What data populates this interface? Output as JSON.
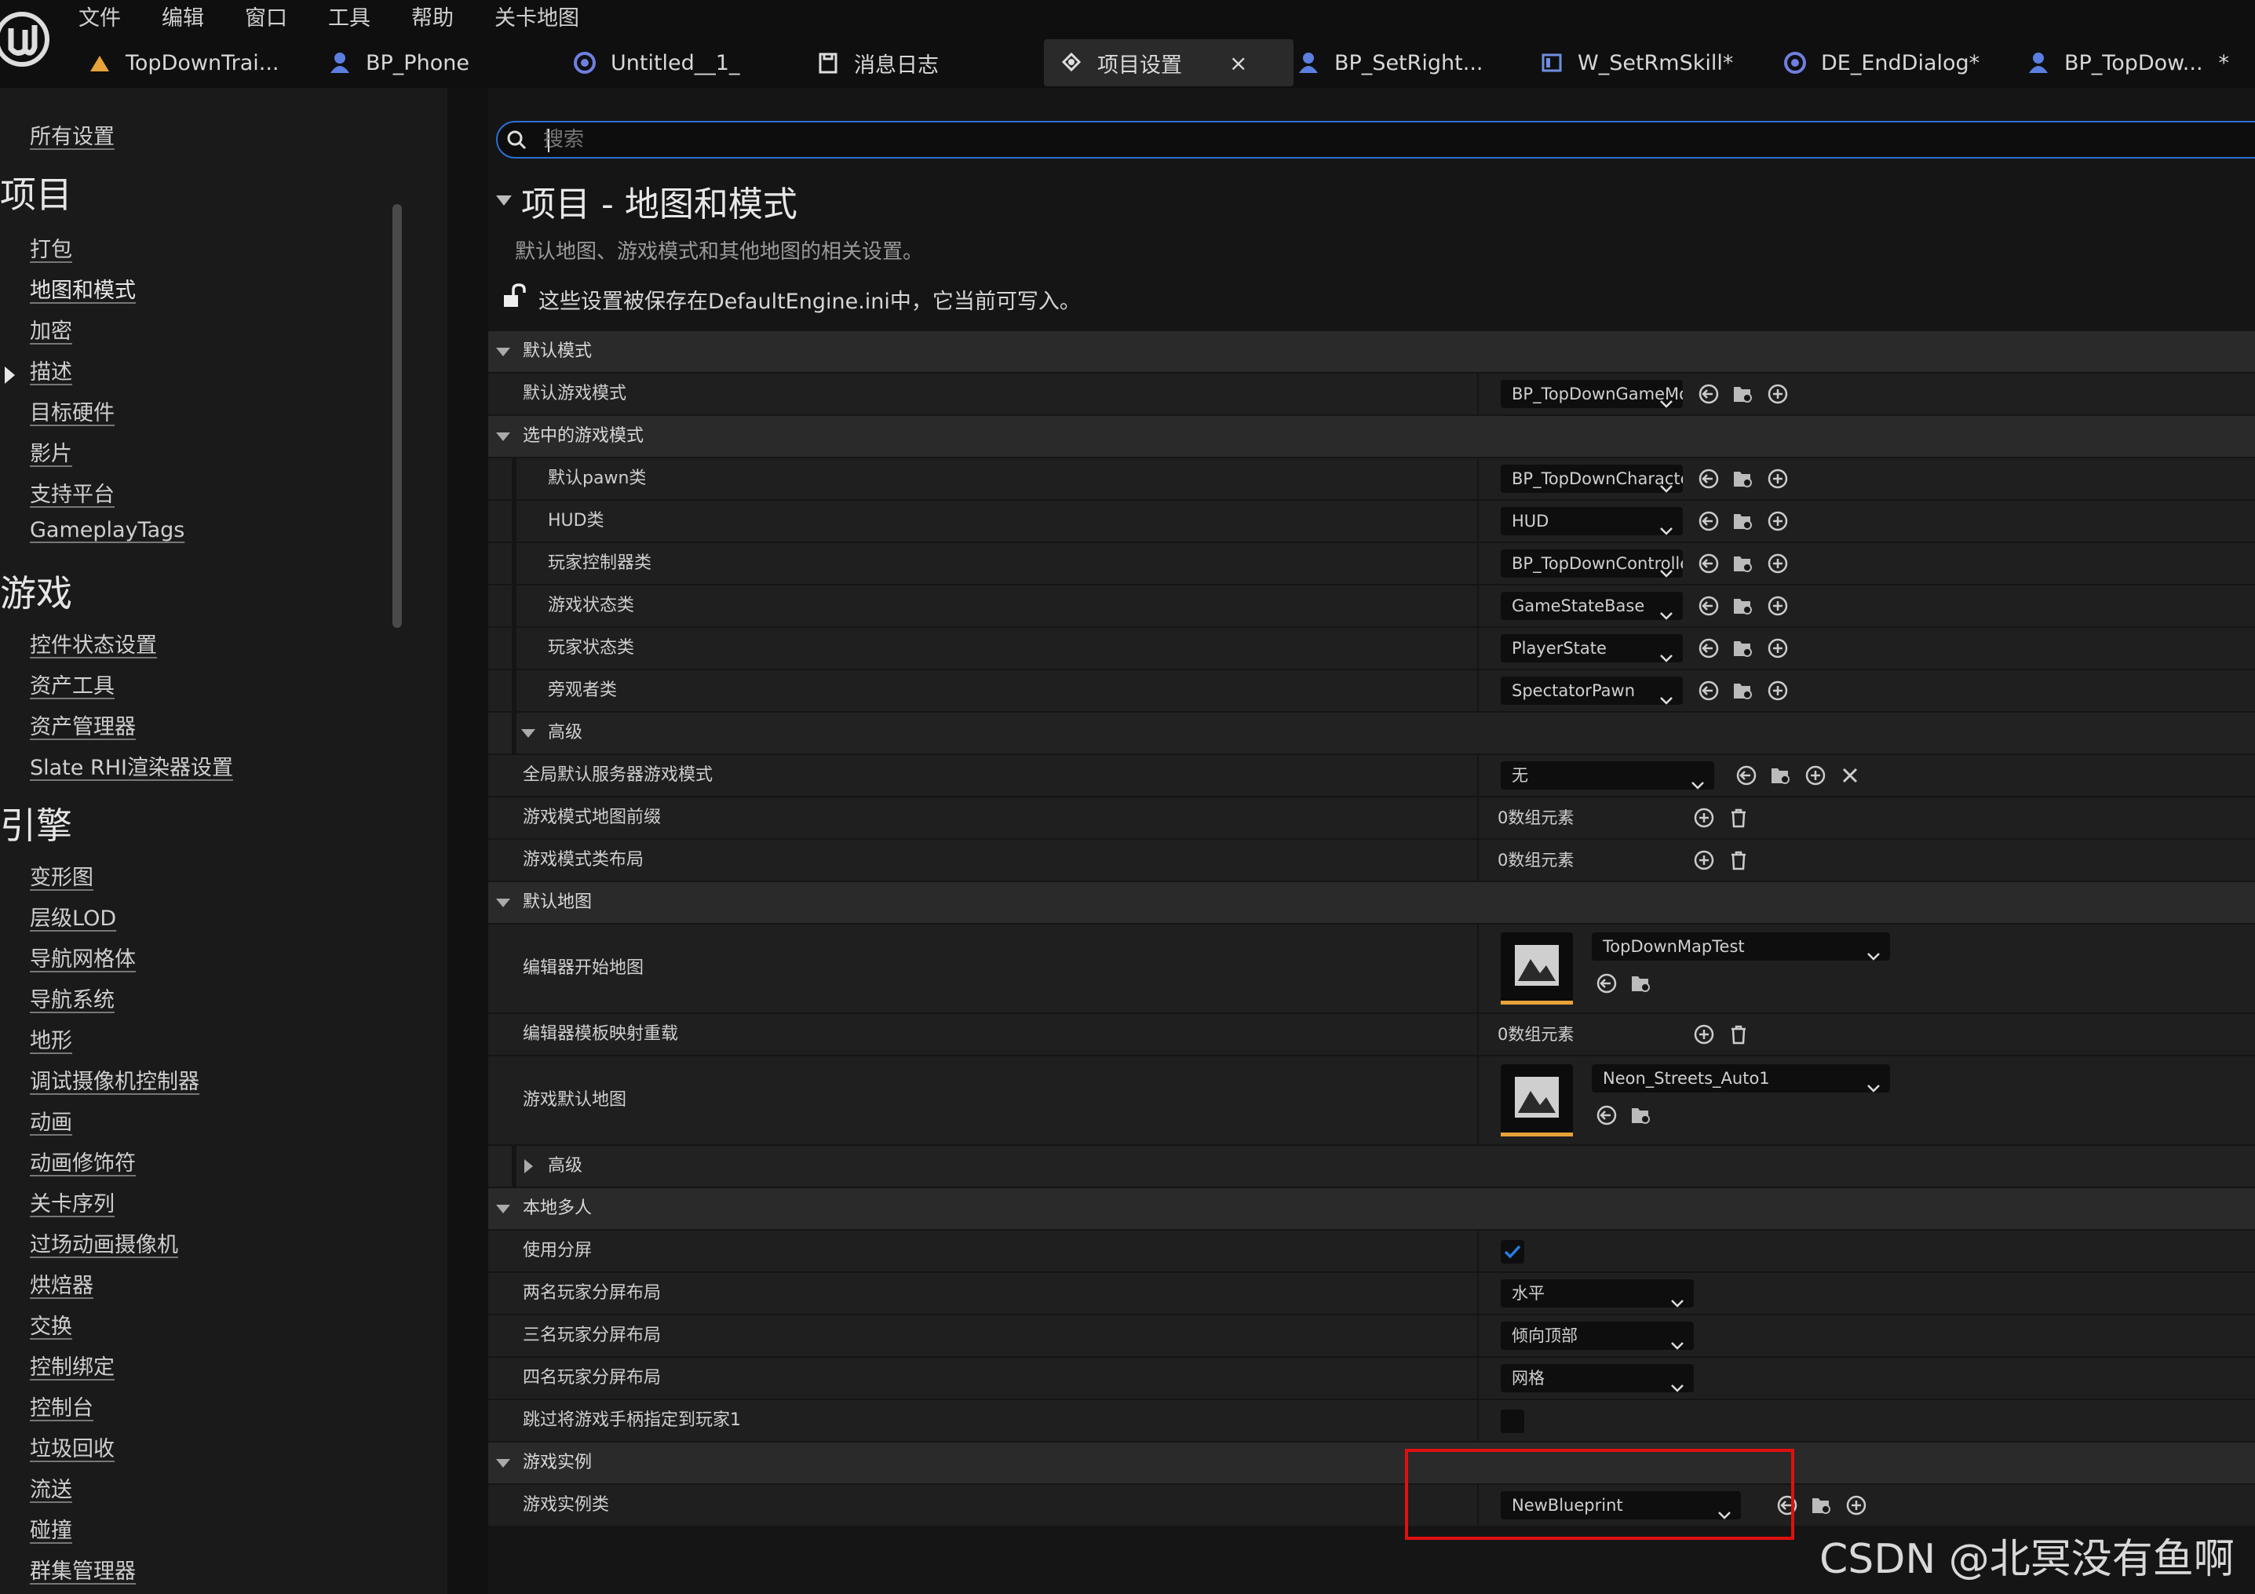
{
  "menu": [
    "文件",
    "编辑",
    "窗口",
    "工具",
    "帮助",
    "关卡地图"
  ],
  "tabs": [
    {
      "label": "TopDownTrai...",
      "icon": "level-icon"
    },
    {
      "label": "BP_Phone",
      "icon": "character-blueprint-icon"
    },
    {
      "label": "Untitled__1_",
      "icon": "blueprint-sphere-icon"
    },
    {
      "label": "消息日志",
      "icon": "message-log-icon"
    },
    {
      "label": "项目设置",
      "icon": "settings-icon",
      "active": true
    },
    {
      "label": "BP_SetRight...",
      "icon": "character-blueprint-icon"
    },
    {
      "label": "W_SetRmSkill*",
      "icon": "widget-blueprint-icon"
    },
    {
      "label": "DE_EndDialog*",
      "icon": "blueprint-sphere-icon"
    },
    {
      "label": "BP_TopDow...",
      "icon": "character-blueprint-icon"
    }
  ],
  "tab_close": "×",
  "tab_more": "*",
  "sidebar": {
    "all_settings": "所有设置",
    "sections": [
      {
        "title": "项目",
        "items": [
          "打包",
          "地图和模式",
          "加密",
          "描述",
          "目标硬件",
          "影片",
          "支持平台",
          "GameplayTags"
        ]
      },
      {
        "title": "游戏",
        "items": [
          "控件状态设置",
          "资产工具",
          "资产管理器",
          "Slate RHI渲染器设置"
        ]
      },
      {
        "title": "引擎",
        "items": [
          "变形图",
          "层级LOD",
          "导航网格体",
          "导航系统",
          "地形",
          "调试摄像机控制器",
          "动画",
          "动画修饰符",
          "关卡序列",
          "过场动画摄像机",
          "烘焙器",
          "交换",
          "控制绑定",
          "控制台",
          "垃圾回收",
          "流送",
          "碰撞",
          "群集管理器"
        ]
      }
    ],
    "selected": "地图和模式"
  },
  "search": {
    "placeholder": "搜索"
  },
  "page": {
    "title": "项目 - 地图和模式",
    "description": "默认地图、游戏模式和其他地图的相关设置。",
    "save_note": "这些设置被保存在DefaultEngine.ini中，它当前可写入。"
  },
  "settings": {
    "cat_default_modes": "默认模式",
    "default_gamemode": {
      "label": "默认游戏模式",
      "value": "BP_TopDownGameMode"
    },
    "cat_selected_gamemode": "选中的游戏模式",
    "pawn_class": {
      "label": "默认pawn类",
      "value": "BP_TopDownCharacter"
    },
    "hud_class": {
      "label": "HUD类",
      "value": "HUD"
    },
    "pc_class": {
      "label": "玩家控制器类",
      "value": "BP_TopDownController"
    },
    "gamestate_class": {
      "label": "游戏状态类",
      "value": "GameStateBase"
    },
    "playerstate_class": {
      "label": "玩家状态类",
      "value": "PlayerState"
    },
    "spectator_class": {
      "label": "旁观者类",
      "value": "SpectatorPawn"
    },
    "cat_advanced": "高级",
    "global_server_gamemode": {
      "label": "全局默认服务器游戏模式",
      "value": "无"
    },
    "gamemode_map_prefixes": {
      "label": "游戏模式地图前缀",
      "value": "0数组元素"
    },
    "gamemode_class_aliases": {
      "label": "游戏模式类布局",
      "value": "0数组元素"
    },
    "cat_default_maps": "默认地图",
    "editor_startup_map": {
      "label": "编辑器开始地图",
      "value": "TopDownMapTest"
    },
    "editor_template_map_overrides": {
      "label": "编辑器模板映射重载",
      "value": "0数组元素"
    },
    "game_default_map": {
      "label": "游戏默认地图",
      "value": "Neon_Streets_Auto1"
    },
    "cat_advanced_2": "高级",
    "cat_local_multiplayer": "本地多人",
    "use_splitscreen": {
      "label": "使用分屏",
      "checked": true
    },
    "two_player_layout": {
      "label": "两名玩家分屏布局",
      "value": "水平"
    },
    "three_player_layout": {
      "label": "三名玩家分屏布局",
      "value": "倾向顶部"
    },
    "four_player_layout": {
      "label": "四名玩家分屏布局",
      "value": "网格"
    },
    "skip_gamepad": {
      "label": "跳过将游戏手柄指定到玩家1",
      "checked": false
    },
    "cat_game_instance": "游戏实例",
    "game_instance_class": {
      "label": "游戏实例类",
      "value": "NewBlueprint"
    }
  },
  "watermark": "CSDN @北冥没有鱼啊",
  "colors": {
    "accent": "#2b6fd6",
    "highlight_box": "#e01010",
    "thumb_bar": "#e8a23a",
    "check": "#2b6fd6"
  }
}
